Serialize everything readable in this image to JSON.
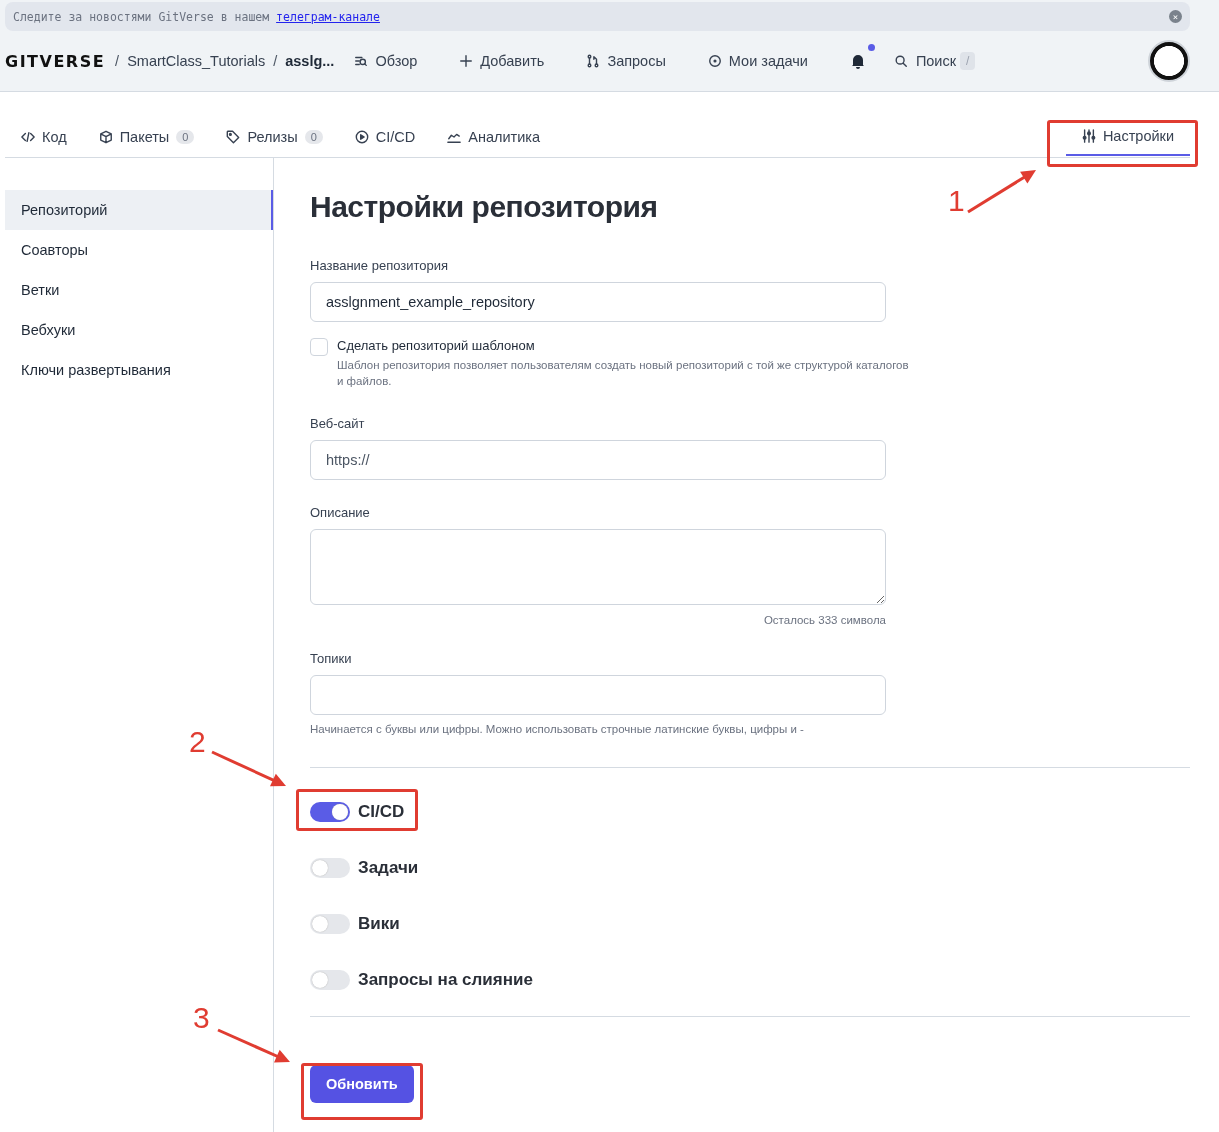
{
  "banner": {
    "text": "Следите за новостями GitVerse в нашем ",
    "link": "телеграм-канале",
    "close": "×"
  },
  "header": {
    "logo": "GITVERSE",
    "breadcrumbs": [
      {
        "separator": "/",
        "label": "SmartClass_Tutorials"
      },
      {
        "separator": "/",
        "label": "asslg..."
      }
    ],
    "nav": [
      {
        "label": "Обзор",
        "kind": "overview"
      },
      {
        "label": "Добавить",
        "kind": "plus"
      },
      {
        "label": "Запросы",
        "kind": "pull"
      },
      {
        "label": "Мои задачи",
        "kind": "issue"
      }
    ],
    "notifications": {
      "unread": true
    },
    "search": {
      "label": "Поиск",
      "shortcut": "/"
    }
  },
  "tabs": [
    {
      "label": "Код",
      "kind": "code",
      "selected": false
    },
    {
      "label": "Пакеты",
      "kind": "package",
      "count": "0",
      "selected": false
    },
    {
      "label": "Релизы",
      "kind": "tag",
      "count": "0",
      "selected": false
    },
    {
      "label": "CI/CD",
      "kind": "play",
      "selected": false
    },
    {
      "label": "Аналитика",
      "kind": "chart",
      "selected": false
    },
    {
      "label": "Настройки",
      "kind": "sliders",
      "selected": true
    }
  ],
  "sidebar": {
    "items": [
      {
        "label": "Репозиторий",
        "selected": true
      },
      {
        "label": "Соавторы",
        "selected": false
      },
      {
        "label": "Ветки",
        "selected": false
      },
      {
        "label": "Вебхуки",
        "selected": false
      },
      {
        "label": "Ключи развертывания",
        "selected": false
      }
    ]
  },
  "form": {
    "title": "Настройки репозитория",
    "name": {
      "label": "Название репозитория",
      "value": "asslgnment_example_repository"
    },
    "template": {
      "label": "Сделать репозиторий шаблоном",
      "hint": "Шаблон репозитория позволяет пользователям создать новый репозиторий с той же структурой каталогов и файлов.",
      "checked": false
    },
    "website": {
      "label": "Веб-сайт",
      "placeholder": "https://"
    },
    "description": {
      "label": "Описание",
      "counter": "Осталось 333 символа"
    },
    "topics": {
      "label": "Топики",
      "hint": "Начинается с буквы или цифры. Можно использовать строчные латинские буквы, цифры и -"
    },
    "toggles": [
      {
        "label": "CI/CD",
        "on": true
      },
      {
        "label": "Задачи",
        "on": false
      },
      {
        "label": "Вики",
        "on": false
      },
      {
        "label": "Запросы на слияние",
        "on": false
      }
    ],
    "submit": "Обновить"
  },
  "annotations": [
    {
      "number": "1"
    },
    {
      "number": "2"
    },
    {
      "number": "3"
    }
  ]
}
